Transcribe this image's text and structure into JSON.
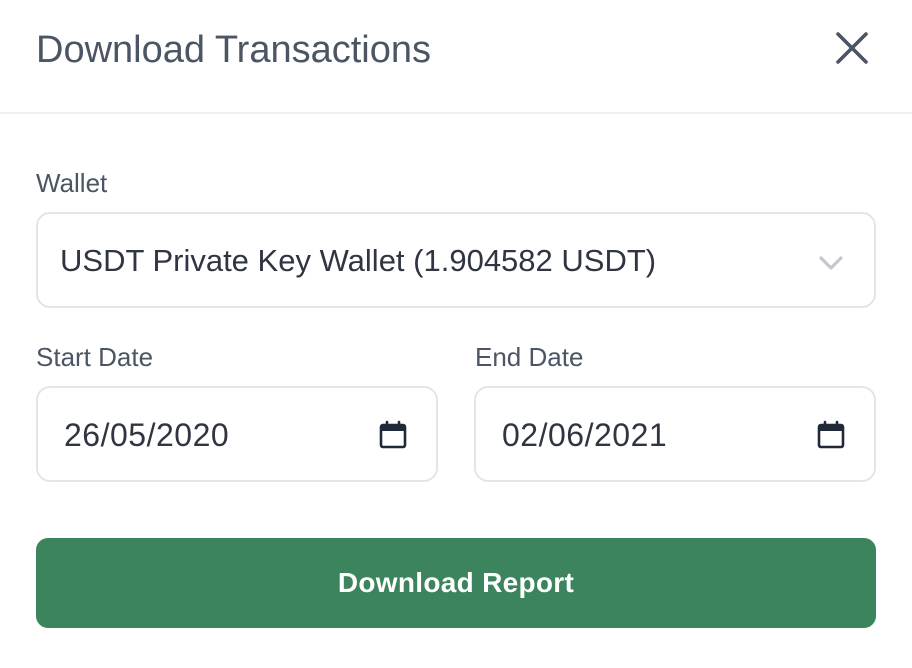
{
  "modal": {
    "title": "Download Transactions",
    "close_icon": "close-icon"
  },
  "wallet": {
    "label": "Wallet",
    "selected_value": "USDT Private Key Wallet (1.904582 USDT)",
    "icon": "chevron-down-icon"
  },
  "start_date": {
    "label": "Start Date",
    "value": "26/05/2020",
    "icon": "calendar-icon"
  },
  "end_date": {
    "label": "End Date",
    "value": "02/06/2021",
    "icon": "calendar-icon"
  },
  "submit": {
    "label": "Download Report"
  },
  "colors": {
    "primary_button": "#3c845d",
    "text": "#374151",
    "border": "#e2e5ea"
  }
}
